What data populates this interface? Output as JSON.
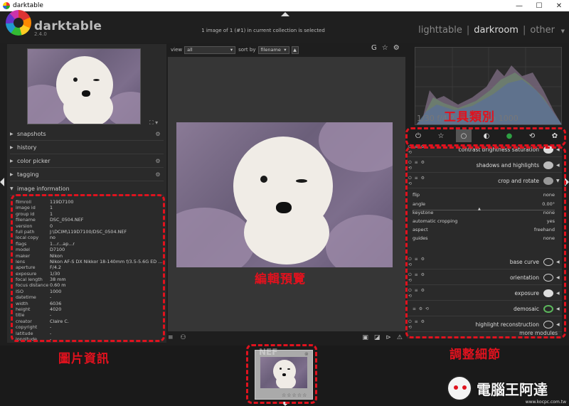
{
  "window": {
    "title": "darktable",
    "minimize": "—",
    "maximize": "☐",
    "close": "✕"
  },
  "header": {
    "app_name": "darktable",
    "version": "2.4.0",
    "selection_status": "1 image of 1 (#1) in current collection is selected",
    "views": [
      "lighttable",
      "darkroom",
      "other"
    ],
    "view_separator": "|",
    "active_view": "darkroom"
  },
  "left_panel": {
    "modules": [
      {
        "label": "snapshots",
        "option": "⚙"
      },
      {
        "label": "history",
        "option": ""
      },
      {
        "label": "color picker",
        "option": "⚙"
      },
      {
        "label": "tagging",
        "option": "⚙"
      },
      {
        "label": "image information",
        "option": ""
      }
    ],
    "image_information": [
      {
        "key": "filmroll",
        "value": "119D7100"
      },
      {
        "key": "image id",
        "value": "1"
      },
      {
        "key": "group id",
        "value": "1"
      },
      {
        "key": "filename",
        "value": "DSC_0504.NEF"
      },
      {
        "key": "version",
        "value": "0"
      },
      {
        "key": "full path",
        "value": "J:\\DCIM\\119D7100/DSC_0504.NEF"
      },
      {
        "key": "local copy",
        "value": "no"
      },
      {
        "key": "flags",
        "value": "1...r...ap...r"
      },
      {
        "key": "model",
        "value": "D7100"
      },
      {
        "key": "maker",
        "value": "Nikon"
      },
      {
        "key": "lens",
        "value": "Nikon AF-S DX Nikkor 18-140mm f/3.5-5.6G ED ..."
      },
      {
        "key": "aperture",
        "value": "F/4.2"
      },
      {
        "key": "exposure",
        "value": "1/30"
      },
      {
        "key": "focal length",
        "value": "38 mm"
      },
      {
        "key": "focus distance",
        "value": "0.60 m"
      },
      {
        "key": "ISO",
        "value": "1000"
      },
      {
        "key": "datetime",
        "value": "-"
      },
      {
        "key": "width",
        "value": "6036"
      },
      {
        "key": "height",
        "value": "4020"
      },
      {
        "key": "title",
        "value": "-"
      },
      {
        "key": "creator",
        "value": "Claire C."
      },
      {
        "key": "copyright",
        "value": "-"
      },
      {
        "key": "latitude",
        "value": "-"
      },
      {
        "key": "longitude",
        "value": "-"
      }
    ]
  },
  "center": {
    "view_label": "view",
    "view_value": "all",
    "sort_label": "sort by",
    "sort_value": "filename",
    "sort_direction": "▲",
    "top_icons": [
      "G",
      "☆",
      "⚙"
    ],
    "bottom_left_icons": [
      "≡",
      "⚇"
    ],
    "bottom_right_icons": [
      "▣",
      "◪",
      "⊳",
      "⚠"
    ]
  },
  "right_panel": {
    "exif_line": "1/30 f/4.2 38mm iso 1000",
    "tool_tabs": [
      {
        "icon": "power-icon",
        "glyph": "⏻",
        "active": false
      },
      {
        "icon": "star-icon",
        "glyph": "☆",
        "active": false
      },
      {
        "icon": "circle-icon",
        "glyph": "○",
        "active": true
      },
      {
        "icon": "tone-icon",
        "glyph": "◐",
        "active": false
      },
      {
        "icon": "color-icon",
        "glyph": "●",
        "active": false
      },
      {
        "icon": "correct-icon",
        "glyph": "⟲",
        "active": false
      },
      {
        "icon": "effect-icon",
        "glyph": "✿",
        "active": false
      }
    ],
    "iop_modules_top": [
      {
        "name": "contrast brightness saturation",
        "icon_color": "#dddddd"
      },
      {
        "name": "shadows and highlights",
        "icon_color": "#cccccc"
      },
      {
        "name": "crop and rotate",
        "icon_color": "#bbbbbb"
      }
    ],
    "crop_params": [
      {
        "label": "flip",
        "value": "none"
      },
      {
        "label": "angle",
        "value": "0.00°"
      },
      {
        "label": "keystone",
        "value": "none"
      },
      {
        "label": "automatic cropping",
        "value": "yes"
      },
      {
        "label": "aspect",
        "value": "freehand"
      },
      {
        "label": "guides",
        "value": "none"
      }
    ],
    "iop_modules_bottom": [
      {
        "name": "base curve",
        "icon_color": "#cccccc"
      },
      {
        "name": "orientation",
        "icon_color": "#cccccc"
      },
      {
        "name": "exposure",
        "icon_color": "#dddddd"
      },
      {
        "name": "demosaic",
        "icon_color": "#5cb85c"
      },
      {
        "name": "highlight reconstruction",
        "icon_color": "#cccccc"
      }
    ],
    "more_modules": "more modules"
  },
  "filmstrip": {
    "ext_label": "NEF",
    "stars": "☆☆☆☆☆",
    "close": "⊗"
  },
  "annotations": {
    "tool_categories": "工具類別",
    "edit_preview": "編輯預覽",
    "image_info": "圖片資訊",
    "adjust_details": "調整細節"
  },
  "watermark": {
    "text": "電腦王阿達",
    "url": "www.kocpc.com.tw"
  }
}
